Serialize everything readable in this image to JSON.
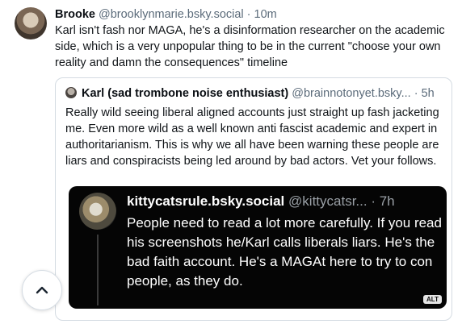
{
  "post": {
    "author_name": "Brooke",
    "handle": "@brooklynmarie.bsky.social",
    "separator": " · ",
    "time": "10m",
    "text": "Karl isn't fash nor MAGA, he's a disinformation researcher on the academic side, which is a very unpopular thing to be in the current \"choose your own reality and damn the consequences\" timeline"
  },
  "quote": {
    "author_name": "Karl (sad trombone noise enthusiast)",
    "handle": "@brainnotonyet.bsky...",
    "separator": " · ",
    "time": "5h",
    "text": "Really wild seeing liberal aligned accounts just straight up fash jacketing me. Even more wild as a well known anti fascist academic and expert in authoritarianism.  This is why we all have been warning these people are liars and conspiracists being led around by bad actors.  Vet your follows."
  },
  "embed": {
    "author_name": "kittycatsrule.bsky.social",
    "handle": "@kittycatsr...",
    "separator": " · ",
    "time": "7h",
    "text": "People need to read a lot more carefully. If you read his screenshots he/Karl calls liberals liars.  He's the bad faith account. He's a MAGAt here to try to con people, as they do.",
    "alt_badge": "ALT"
  },
  "icons": {
    "scroll_top": "chevron-up-icon"
  }
}
